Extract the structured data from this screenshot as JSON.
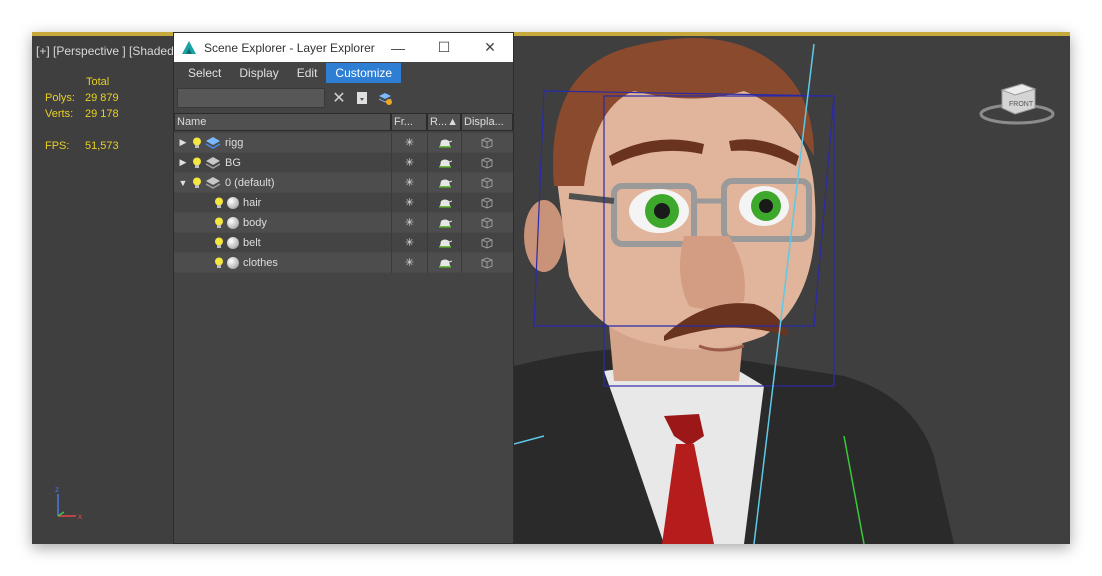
{
  "viewport": {
    "label": "[+] [Perspective ] [Shaded",
    "stats": {
      "header": "Total",
      "polys_label": "Polys:",
      "polys_value": "29 879",
      "verts_label": "Verts:",
      "verts_value": "29 178",
      "fps_label": "FPS:",
      "fps_value": "51,573"
    },
    "viewcube_face": "FRONT"
  },
  "explorer": {
    "title": "Scene Explorer - Layer Explorer",
    "window_controls": {
      "minimize": "—",
      "maximize": "☐",
      "close": "✕"
    },
    "menu": [
      "Select",
      "Display",
      "Edit",
      "Customize"
    ],
    "search": {
      "value": "",
      "placeholder": ""
    },
    "columns": [
      "Name",
      "Fr...",
      "R...▲",
      "Displa..."
    ],
    "rows": [
      {
        "name": "rigg",
        "expand": "collapsed"
      },
      {
        "name": "BG",
        "expand": "collapsed"
      },
      {
        "name": "0 (default)",
        "expand": "expanded"
      },
      {
        "name": "hair"
      },
      {
        "name": "body"
      },
      {
        "name": "belt"
      },
      {
        "name": "clothes"
      }
    ]
  },
  "colors": {
    "accent": "#2e7fd4",
    "stat_yellow": "#e8cf25",
    "viewport_bg": "#3f3f3f",
    "panel_bg": "#444444"
  }
}
